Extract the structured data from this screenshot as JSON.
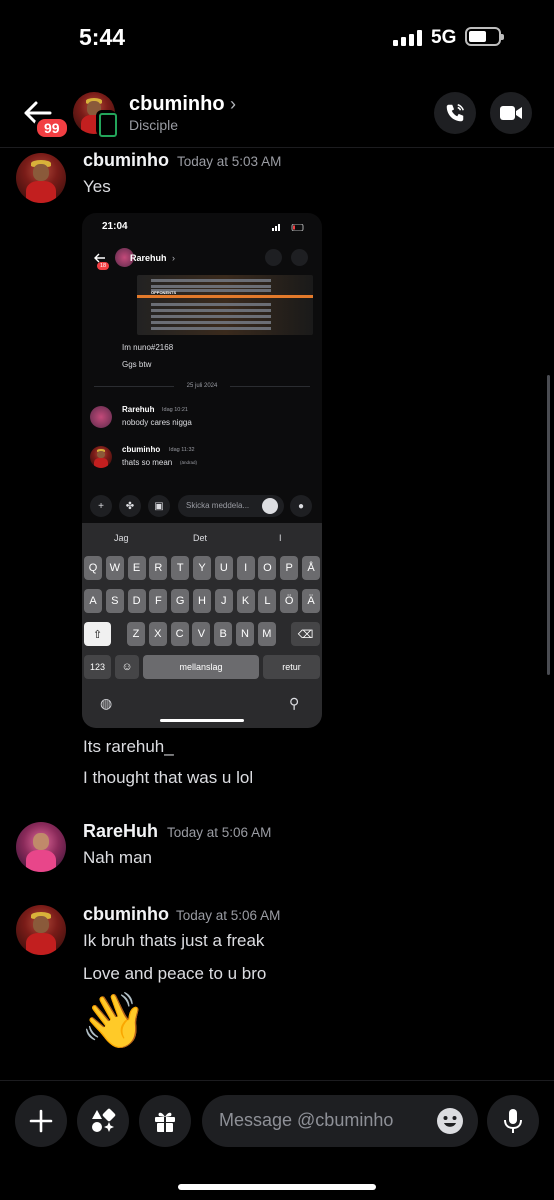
{
  "status_bar": {
    "time": "5:44",
    "network": "5G"
  },
  "header": {
    "unread_count": "99",
    "name": "cbuminho",
    "chevron": "›",
    "subtitle": "Disciple"
  },
  "messages": [
    {
      "author": "cbuminho",
      "time": "Today at 5:03 AM",
      "lines": [
        "Yes"
      ]
    },
    {
      "continuation_lines": [
        "Its rarehuh_",
        "I thought that was u lol"
      ]
    },
    {
      "author": "RareHuh",
      "time": "Today at 5:06 AM",
      "lines": [
        "Nah man"
      ]
    },
    {
      "author": "cbuminho",
      "time": "Today at 5:06 AM",
      "lines": [
        "Ik bruh thats just a freak",
        "Love and peace to u bro"
      ],
      "emoji": "👋"
    }
  ],
  "screenshot": {
    "time": "21:04",
    "badge": "18",
    "name": "Rarehuh",
    "chevron": "›",
    "game_label": "OPPONENTS",
    "text_lines": [
      "Im nuno#2168",
      "Ggs btw"
    ],
    "date": "25 juli 2024",
    "msgs": [
      {
        "author": "Rarehuh",
        "time": "Idag 10:21",
        "text": "nobody cares nigga"
      },
      {
        "author": "cbuminho",
        "time": "Idag 11:32",
        "text": "thats so mean",
        "edited": "(ändrad)"
      }
    ],
    "input_placeholder": "Skicka meddela...",
    "suggestions": [
      "Jag",
      "Det",
      "I"
    ],
    "row1": [
      "Q",
      "W",
      "E",
      "R",
      "T",
      "Y",
      "U",
      "I",
      "O",
      "P",
      "Å"
    ],
    "row2": [
      "A",
      "S",
      "D",
      "F",
      "G",
      "H",
      "J",
      "K",
      "L",
      "Ö",
      "Ä"
    ],
    "row3": [
      "Z",
      "X",
      "C",
      "V",
      "B",
      "N",
      "M"
    ],
    "key_123": "123",
    "key_space": "mellanslag",
    "key_return": "retur"
  },
  "composer": {
    "placeholder": "Message @cbuminho"
  },
  "icons": [
    "back-arrow-icon",
    "phone-call-icon",
    "video-camera-icon",
    "plus-icon",
    "apps-icon",
    "gift-icon",
    "emoji-icon",
    "microphone-icon"
  ]
}
